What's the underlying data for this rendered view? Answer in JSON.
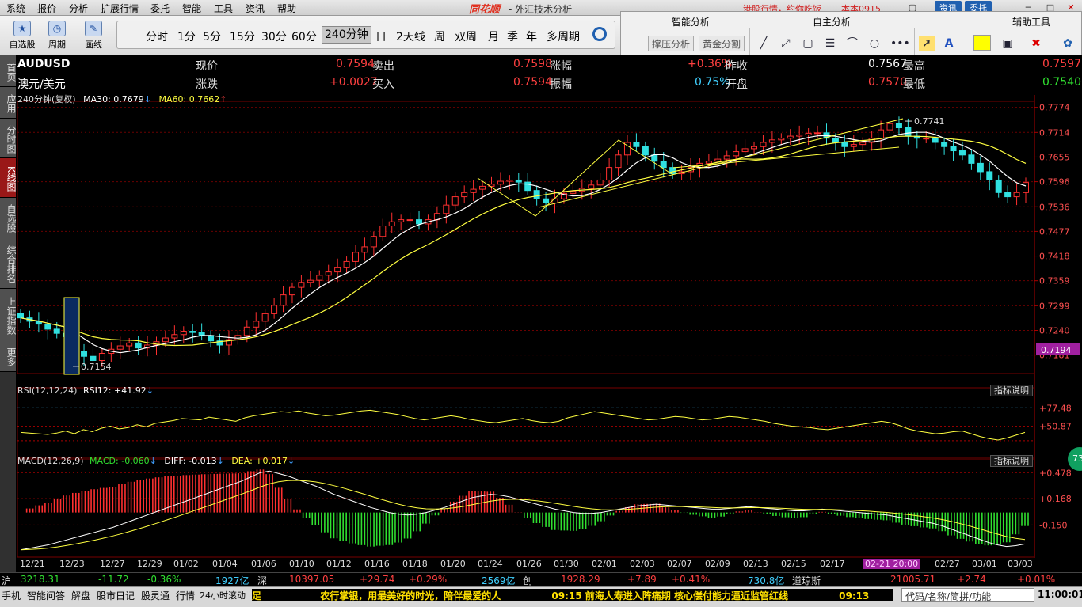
{
  "menu": [
    "系统",
    "报价",
    "分析",
    "扩展行情",
    "委托",
    "智能",
    "工具",
    "资讯",
    "帮助"
  ],
  "app": {
    "logo": "同花顺",
    "title": "- 外汇技术分析",
    "ticker_text": "港股行情，约你吃饭",
    "ticker_extra": "本本0915",
    "btn_news": "资讯",
    "btn_trade": "委托"
  },
  "toolbar": {
    "big_buttons": [
      {
        "label": "自选股",
        "icon": "star-icon"
      },
      {
        "label": "周期",
        "icon": "clock-icon"
      },
      {
        "label": "画线",
        "icon": "pencil-icon"
      }
    ],
    "periods": [
      "分时",
      "1分",
      "5分",
      "15分",
      "30分",
      "60分",
      "240分钟",
      "日",
      "2天线",
      "周",
      "双周",
      "月",
      "季",
      "年",
      "多周期"
    ],
    "active_period": "240分钟"
  },
  "toolpanel": {
    "smart": "智能分析",
    "self": "自主分析",
    "aux": "辅助工具",
    "btn_press": "撑压分析",
    "btn_gold": "黄金分割"
  },
  "sidebar": [
    "首页",
    "应用",
    "分时图",
    "K线图",
    "自选股",
    "综合排名",
    "上证指数",
    "更多"
  ],
  "quote": {
    "symbol": "AUDUSD",
    "name": "澳元/美元",
    "labels": {
      "now": "现价",
      "sell": "卖出",
      "rise": "涨幅",
      "prev": "昨收",
      "high": "最高",
      "change": "涨跌",
      "buy": "买入",
      "amp": "振幅",
      "open": "开盘",
      "low": "最低"
    },
    "now": "0.7594",
    "sell": "0.7598",
    "rise": "+0.36%",
    "prev": "0.7567",
    "high": "0.7597",
    "change": "+0.0027",
    "buy": "0.7594",
    "amp": "0.75%",
    "open": "0.7570",
    "low": "0.7540"
  },
  "indicators": {
    "main": {
      "period": "240分钟(复权)",
      "ma30": "MA30: 0.7679",
      "ma60": "MA60: 0.7662",
      "ma30_arrow": "↓",
      "ma60_arrow": "↑"
    },
    "rsi": {
      "name": "RSI(12,12,24)",
      "value": "RSI12: +41.92",
      "arrow": "↓"
    },
    "macd": {
      "name": "MACD(12,26,9)",
      "macd": "MACD: -0.060",
      "diff": "DIFF: -0.013",
      "dea": "DEA: +0.017",
      "arrow": "↓"
    },
    "explain": "指标说明"
  },
  "chart_data": {
    "type": "candlestick",
    "symbol": "AUDUSD",
    "price_axis": [
      0.7774,
      0.7714,
      0.7655,
      0.7596,
      0.7536,
      0.7477,
      0.7418,
      0.7359,
      0.7299,
      0.724,
      0.7181
    ],
    "current_price": "0.7194",
    "ylim": [
      0.7154,
      0.7774
    ],
    "marked_high": {
      "value": 0.7741,
      "label": "0.7741"
    },
    "marked_low": {
      "value": 0.7154,
      "label": "0.7154"
    },
    "close_series": [
      0.727,
      0.7262,
      0.7255,
      0.7243,
      0.7233,
      0.7225,
      0.719,
      0.7178,
      0.7168,
      0.7185,
      0.7195,
      0.7203,
      0.721,
      0.7198,
      0.7205,
      0.7213,
      0.7222,
      0.723,
      0.7238,
      0.7235,
      0.7228,
      0.7215,
      0.7205,
      0.7218,
      0.7228,
      0.7248,
      0.7262,
      0.728,
      0.73,
      0.7325,
      0.7343,
      0.7355,
      0.736,
      0.7372,
      0.738,
      0.739,
      0.7405,
      0.7427,
      0.744,
      0.7465,
      0.749,
      0.75,
      0.7505,
      0.7505,
      0.7495,
      0.7505,
      0.752,
      0.754,
      0.756,
      0.757,
      0.7578,
      0.7585,
      0.759,
      0.7597,
      0.76,
      0.7595,
      0.7575,
      0.7555,
      0.7545,
      0.7555,
      0.7568,
      0.7573,
      0.758,
      0.7588,
      0.76,
      0.763,
      0.766,
      0.769,
      0.768,
      0.766,
      0.7645,
      0.763,
      0.7615,
      0.762,
      0.763,
      0.764,
      0.7645,
      0.765,
      0.7658,
      0.7668,
      0.7675,
      0.768,
      0.769,
      0.7696,
      0.77,
      0.7705,
      0.7708,
      0.7712,
      0.7713,
      0.77,
      0.769,
      0.768,
      0.7685,
      0.769,
      0.77,
      0.772,
      0.7735,
      0.7725,
      0.7705,
      0.77,
      0.77,
      0.769,
      0.768,
      0.767,
      0.766,
      0.764,
      0.762,
      0.76,
      0.757,
      0.756,
      0.757,
      0.7594
    ],
    "rsi_axis": [
      "+77.48",
      "+50.87"
    ],
    "rsi_series": [
      42,
      41,
      40,
      39,
      41,
      44,
      40,
      46,
      43,
      48,
      51,
      47,
      49,
      53,
      50,
      55,
      57,
      59,
      62,
      61,
      60,
      64,
      62,
      60,
      58,
      63,
      66,
      68,
      70,
      72,
      71,
      73,
      70,
      68,
      66,
      67,
      69,
      71,
      73,
      74,
      72,
      70,
      68,
      65,
      62,
      60,
      62,
      64,
      66,
      64,
      61,
      59,
      57,
      56,
      58,
      60,
      62,
      59,
      57,
      56,
      58,
      63,
      66,
      69,
      72,
      70,
      68,
      66,
      64,
      62,
      60,
      61,
      63,
      65,
      64,
      62,
      60,
      61,
      63,
      65,
      64,
      62,
      60,
      58,
      55,
      53,
      51,
      50,
      49,
      47,
      46,
      48,
      50,
      52,
      54,
      56,
      58,
      56,
      52,
      47,
      44,
      42,
      40,
      41,
      43,
      44,
      40,
      36,
      33,
      31,
      34,
      38,
      42
    ],
    "macd_axis": [
      "+0.478",
      "+0.168",
      "-0.150"
    ],
    "diff_series": [
      -0.45,
      -0.43,
      -0.41,
      -0.39,
      -0.36,
      -0.33,
      -0.3,
      -0.27,
      -0.24,
      -0.21,
      -0.18,
      -0.14,
      -0.1,
      -0.06,
      -0.02,
      0.02,
      0.06,
      0.1,
      0.14,
      0.18,
      0.22,
      0.26,
      0.3,
      0.34,
      0.38,
      0.43,
      0.48,
      0.5,
      0.47,
      0.44,
      0.4,
      0.36,
      0.32,
      0.27,
      0.22,
      0.18,
      0.14,
      0.1,
      0.06,
      0.03,
      0.0,
      -0.02,
      -0.03,
      -0.02,
      0.0,
      0.03,
      0.06,
      0.1,
      0.14,
      0.18,
      0.2,
      0.22,
      0.21,
      0.19,
      0.16,
      0.13,
      0.1,
      0.07,
      0.04,
      0.02,
      0.0,
      -0.01,
      -0.01,
      0.0,
      0.02,
      0.04,
      0.06,
      0.08,
      0.09,
      0.1,
      0.09,
      0.08,
      0.07,
      0.06,
      0.05,
      0.04,
      0.04,
      0.05,
      0.06,
      0.07,
      0.06,
      0.05,
      0.04,
      0.03,
      0.02,
      0.02,
      0.03,
      0.04,
      0.03,
      0.02,
      0.01,
      0.0,
      -0.01,
      -0.02,
      -0.03,
      -0.05,
      -0.07,
      -0.09,
      -0.11,
      -0.13,
      -0.16,
      -0.2,
      -0.24,
      -0.28,
      -0.32,
      -0.36,
      -0.39,
      -0.41,
      -0.4,
      -0.38
    ]
  },
  "dates": [
    "12/21",
    "12/23",
    "12/27",
    "12/29",
    "01/02",
    "01/04",
    "01/06",
    "01/10",
    "01/12",
    "01/16",
    "01/18",
    "01/20",
    "01/24",
    "01/26",
    "01/30",
    "02/01",
    "02/03",
    "02/07",
    "02/09",
    "02/13",
    "02/15",
    "02/17",
    "02-21 20:00",
    "02/27",
    "03/01",
    "03/03"
  ],
  "index_bar": {
    "sh_label": "沪",
    "sh_val": "3218.31",
    "sh_chg": "-11.72",
    "sh_pct": "-0.36%",
    "sh_amt": "1927亿",
    "sz_label": "深",
    "sz_val": "10397.05",
    "sz_chg": "+29.74",
    "sz_pct": "+0.29%",
    "sz_amt": "2569亿",
    "cy_label": "创",
    "cy_val": "1928.29",
    "cy_chg": "+7.89",
    "cy_pct": "+0.41%",
    "cy_amt": "730.8亿",
    "dj_label": "道琼斯",
    "dj_val": "21005.71",
    "dj_chg": "+2.74",
    "dj_pct": "+0.01%"
  },
  "statusbar": {
    "items": [
      "手机",
      "智能问答",
      "解盘",
      "股市日记",
      "股灵通",
      "行情",
      "24小时滚动"
    ],
    "foot": "足",
    "news1": "农行掌银，用最美好的时光，陪伴最爱的人",
    "news2": "09:15 前海人寿进入阵痛期 核心偿付能力逼近监管红线",
    "news_time": "09:13",
    "search": "代码/名称/简拼/功能",
    "clock": "11:00:01"
  },
  "badge": "73"
}
